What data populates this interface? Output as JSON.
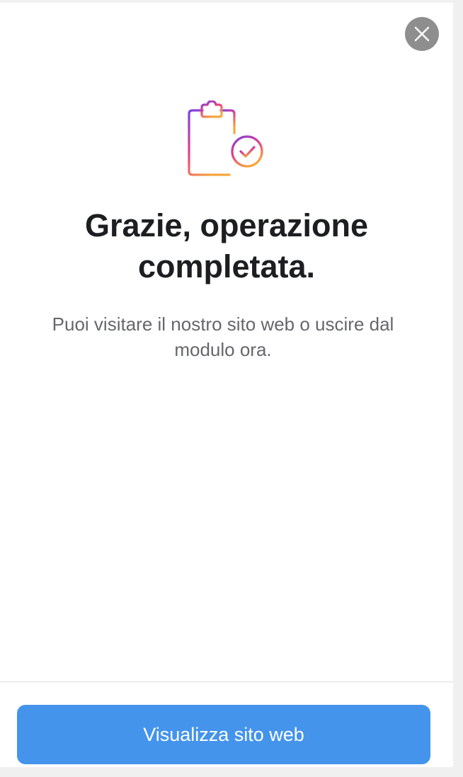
{
  "dialog": {
    "close_icon": "close-icon",
    "hero_icon": "clipboard-check-icon",
    "title": "Grazie, operazione completata.",
    "subtitle": "Puoi visitare il nostro sito web o uscire dal modulo ora."
  },
  "footer": {
    "primary_button_label": "Visualizza sito web"
  },
  "colors": {
    "primary": "#4494ec",
    "close_bg": "#8e8e8e",
    "title": "#1c1e21",
    "subtitle": "#65676b",
    "icon_gradient": [
      "#7b3fe4",
      "#e0408a",
      "#f7a63b"
    ]
  }
}
